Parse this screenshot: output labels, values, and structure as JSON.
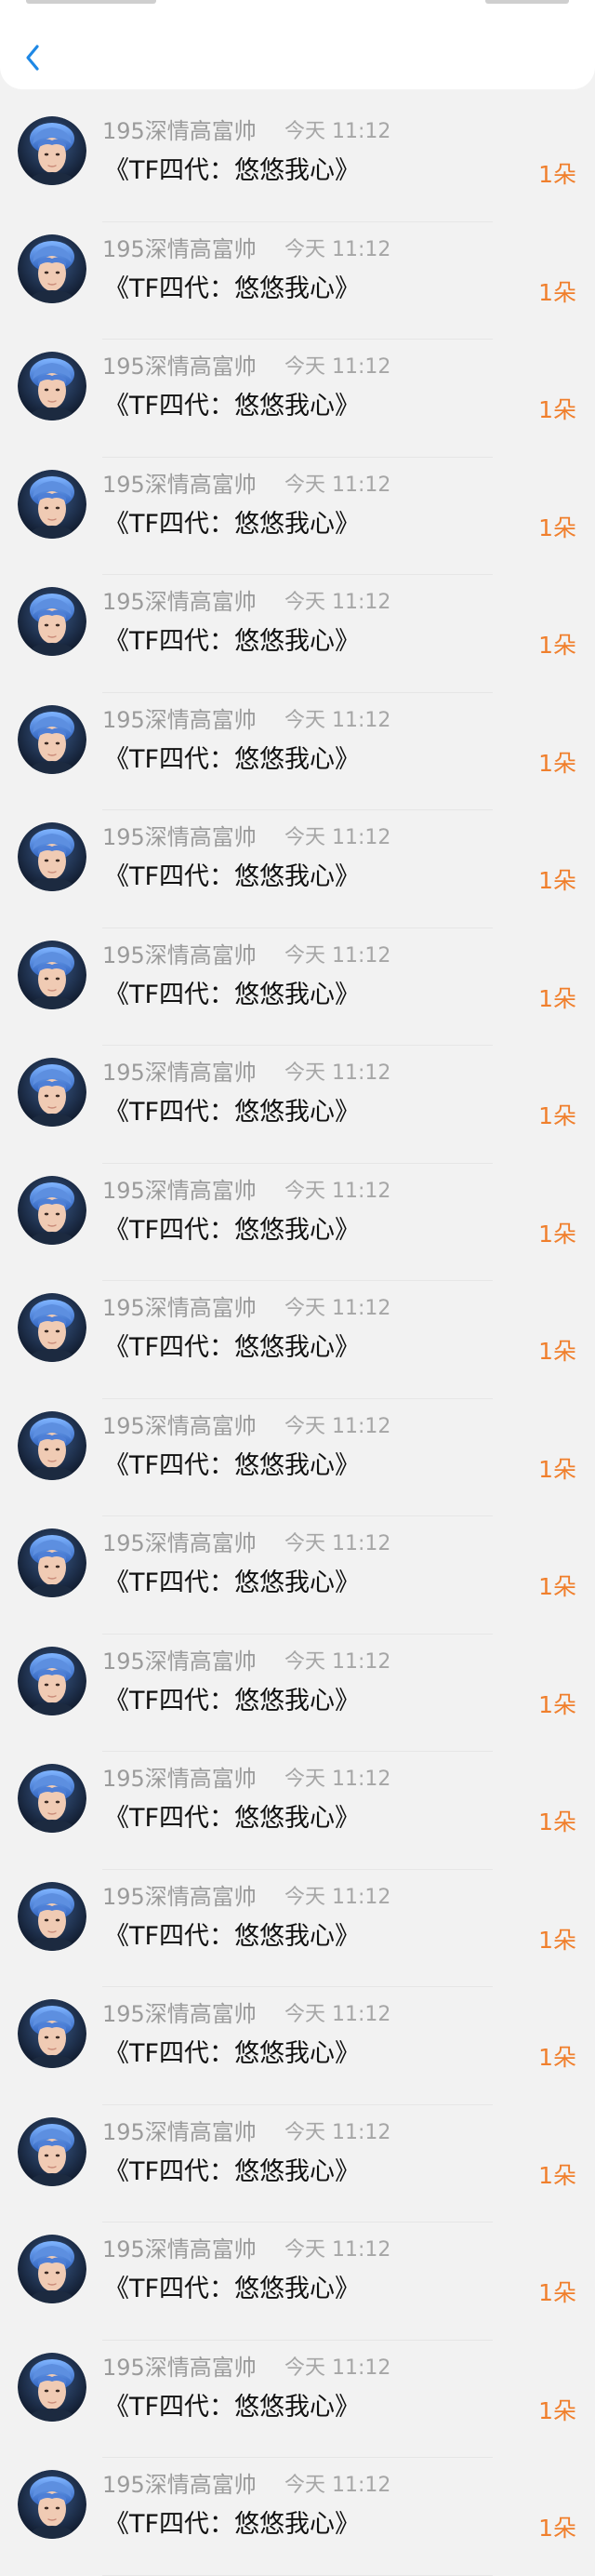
{
  "header": {
    "back_label": "<"
  },
  "colors": {
    "accent_blue": "#1e88e5",
    "gift_orange": "#f07f2c",
    "name_grey": "#9b9b9b",
    "title_black": "#111111",
    "background": "#f2f2f2"
  },
  "list": {
    "items": [
      {
        "name": "195深情高富帅",
        "time": "今天 11:12",
        "title": "《TF四代：悠悠我心》",
        "count": "1朵"
      },
      {
        "name": "195深情高富帅",
        "time": "今天 11:12",
        "title": "《TF四代：悠悠我心》",
        "count": "1朵"
      },
      {
        "name": "195深情高富帅",
        "time": "今天 11:12",
        "title": "《TF四代：悠悠我心》",
        "count": "1朵"
      },
      {
        "name": "195深情高富帅",
        "time": "今天 11:12",
        "title": "《TF四代：悠悠我心》",
        "count": "1朵"
      },
      {
        "name": "195深情高富帅",
        "time": "今天 11:12",
        "title": "《TF四代：悠悠我心》",
        "count": "1朵"
      },
      {
        "name": "195深情高富帅",
        "time": "今天 11:12",
        "title": "《TF四代：悠悠我心》",
        "count": "1朵"
      },
      {
        "name": "195深情高富帅",
        "time": "今天 11:12",
        "title": "《TF四代：悠悠我心》",
        "count": "1朵"
      },
      {
        "name": "195深情高富帅",
        "time": "今天 11:12",
        "title": "《TF四代：悠悠我心》",
        "count": "1朵"
      },
      {
        "name": "195深情高富帅",
        "time": "今天 11:12",
        "title": "《TF四代：悠悠我心》",
        "count": "1朵"
      },
      {
        "name": "195深情高富帅",
        "time": "今天 11:12",
        "title": "《TF四代：悠悠我心》",
        "count": "1朵"
      },
      {
        "name": "195深情高富帅",
        "time": "今天 11:12",
        "title": "《TF四代：悠悠我心》",
        "count": "1朵"
      },
      {
        "name": "195深情高富帅",
        "time": "今天 11:12",
        "title": "《TF四代：悠悠我心》",
        "count": "1朵"
      },
      {
        "name": "195深情高富帅",
        "time": "今天 11:12",
        "title": "《TF四代：悠悠我心》",
        "count": "1朵"
      },
      {
        "name": "195深情高富帅",
        "time": "今天 11:12",
        "title": "《TF四代：悠悠我心》",
        "count": "1朵"
      },
      {
        "name": "195深情高富帅",
        "time": "今天 11:12",
        "title": "《TF四代：悠悠我心》",
        "count": "1朵"
      },
      {
        "name": "195深情高富帅",
        "time": "今天 11:12",
        "title": "《TF四代：悠悠我心》",
        "count": "1朵"
      },
      {
        "name": "195深情高富帅",
        "time": "今天 11:12",
        "title": "《TF四代：悠悠我心》",
        "count": "1朵"
      },
      {
        "name": "195深情高富帅",
        "time": "今天 11:12",
        "title": "《TF四代：悠悠我心》",
        "count": "1朵"
      },
      {
        "name": "195深情高富帅",
        "time": "今天 11:12",
        "title": "《TF四代：悠悠我心》",
        "count": "1朵"
      },
      {
        "name": "195深情高富帅",
        "time": "今天 11:12",
        "title": "《TF四代：悠悠我心》",
        "count": "1朵"
      },
      {
        "name": "195深情高富帅",
        "time": "今天 11:12",
        "title": "《TF四代：悠悠我心》",
        "count": "1朵"
      }
    ]
  }
}
